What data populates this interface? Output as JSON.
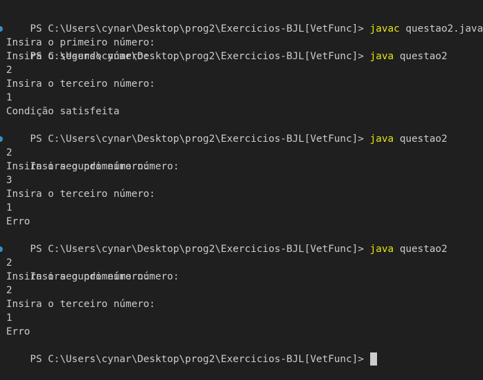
{
  "terminal": {
    "lines": [
      {
        "kind": "prompt",
        "prompt": "PS C:\\Users\\cynar\\Desktop\\prog2\\Exercicios-BJL[VetFunc]> ",
        "command": "javac",
        "args": " questao2.java"
      },
      {
        "kind": "prompt",
        "prompt": "PS C:\\Users\\cynar\\Desktop\\prog2\\Exercicios-BJL[VetFunc]> ",
        "command": "java",
        "args": " questao2"
      },
      {
        "kind": "output",
        "text": "Insira o primeiro número:"
      },
      {
        "kind": "output",
        "text": "Insira o segundo número:"
      },
      {
        "kind": "output",
        "text": "2"
      },
      {
        "kind": "output",
        "text": "Insira o terceiro número:"
      },
      {
        "kind": "output",
        "text": "1"
      },
      {
        "kind": "output",
        "text": "Condição satisfeita"
      },
      {
        "kind": "prompt",
        "prompt": "PS C:\\Users\\cynar\\Desktop\\prog2\\Exercicios-BJL[VetFunc]> ",
        "command": "java",
        "args": " questao2"
      },
      {
        "kind": "output",
        "text": "Insira o primeiro número:"
      },
      {
        "kind": "output",
        "text": "2"
      },
      {
        "kind": "output",
        "text": "Insira o segundo número:"
      },
      {
        "kind": "output",
        "text": "3"
      },
      {
        "kind": "output",
        "text": "Insira o terceiro número:"
      },
      {
        "kind": "output",
        "text": "1"
      },
      {
        "kind": "output",
        "text": "Erro"
      },
      {
        "kind": "prompt",
        "prompt": "PS C:\\Users\\cynar\\Desktop\\prog2\\Exercicios-BJL[VetFunc]> ",
        "command": "java",
        "args": " questao2"
      },
      {
        "kind": "output",
        "text": "Insira o primeiro número:"
      },
      {
        "kind": "output",
        "text": "2"
      },
      {
        "kind": "output",
        "text": "Insira o segundo número:"
      },
      {
        "kind": "output",
        "text": "2"
      },
      {
        "kind": "output",
        "text": "Insira o terceiro número:"
      },
      {
        "kind": "output",
        "text": "1"
      },
      {
        "kind": "output",
        "text": "Erro"
      },
      {
        "kind": "input",
        "prompt": "PS C:\\Users\\cynar\\Desktop\\prog2\\Exercicios-BJL[VetFunc]> "
      }
    ]
  },
  "colors": {
    "background": "#1f1f1f",
    "text": "#cccccc",
    "command": "#e5e510",
    "decoration_marker": "#3b8ec2"
  }
}
